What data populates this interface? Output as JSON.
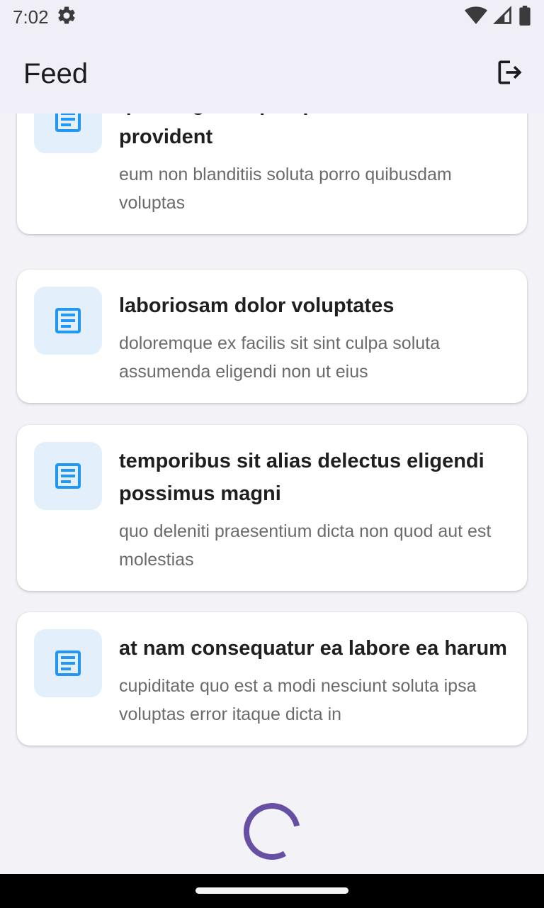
{
  "status_bar": {
    "time": "7:02",
    "icons": [
      "settings-icon",
      "wifi-icon",
      "signal-icon",
      "battery-icon"
    ]
  },
  "app_bar": {
    "title": "Feed",
    "action_icon": "logout-icon"
  },
  "feed": {
    "items": [
      {
        "title": "quas fugiat ut perspiciatis vero provident",
        "description": "eum non blanditiis soluta porro quibusdam voluptas",
        "icon": "document-icon"
      },
      {
        "title": "laboriosam dolor voluptates",
        "description": "doloremque ex facilis sit sint culpa soluta assumenda eligendi non ut eius",
        "icon": "document-icon"
      },
      {
        "title": "temporibus sit alias delectus eligendi possimus magni",
        "description": "quo deleniti praesentium dicta non quod aut est molestias",
        "icon": "document-icon"
      },
      {
        "title": "at nam consequatur ea labore ea harum",
        "description": "cupiditate quo est a modi nesciunt soluta ipsa voluptas error itaque dicta in",
        "icon": "document-icon"
      }
    ]
  },
  "colors": {
    "accent": "#6750a4",
    "icon_blue": "#2196f3",
    "icon_bg": "#e3f0fc",
    "app_bar_bg": "#f0eef6"
  }
}
